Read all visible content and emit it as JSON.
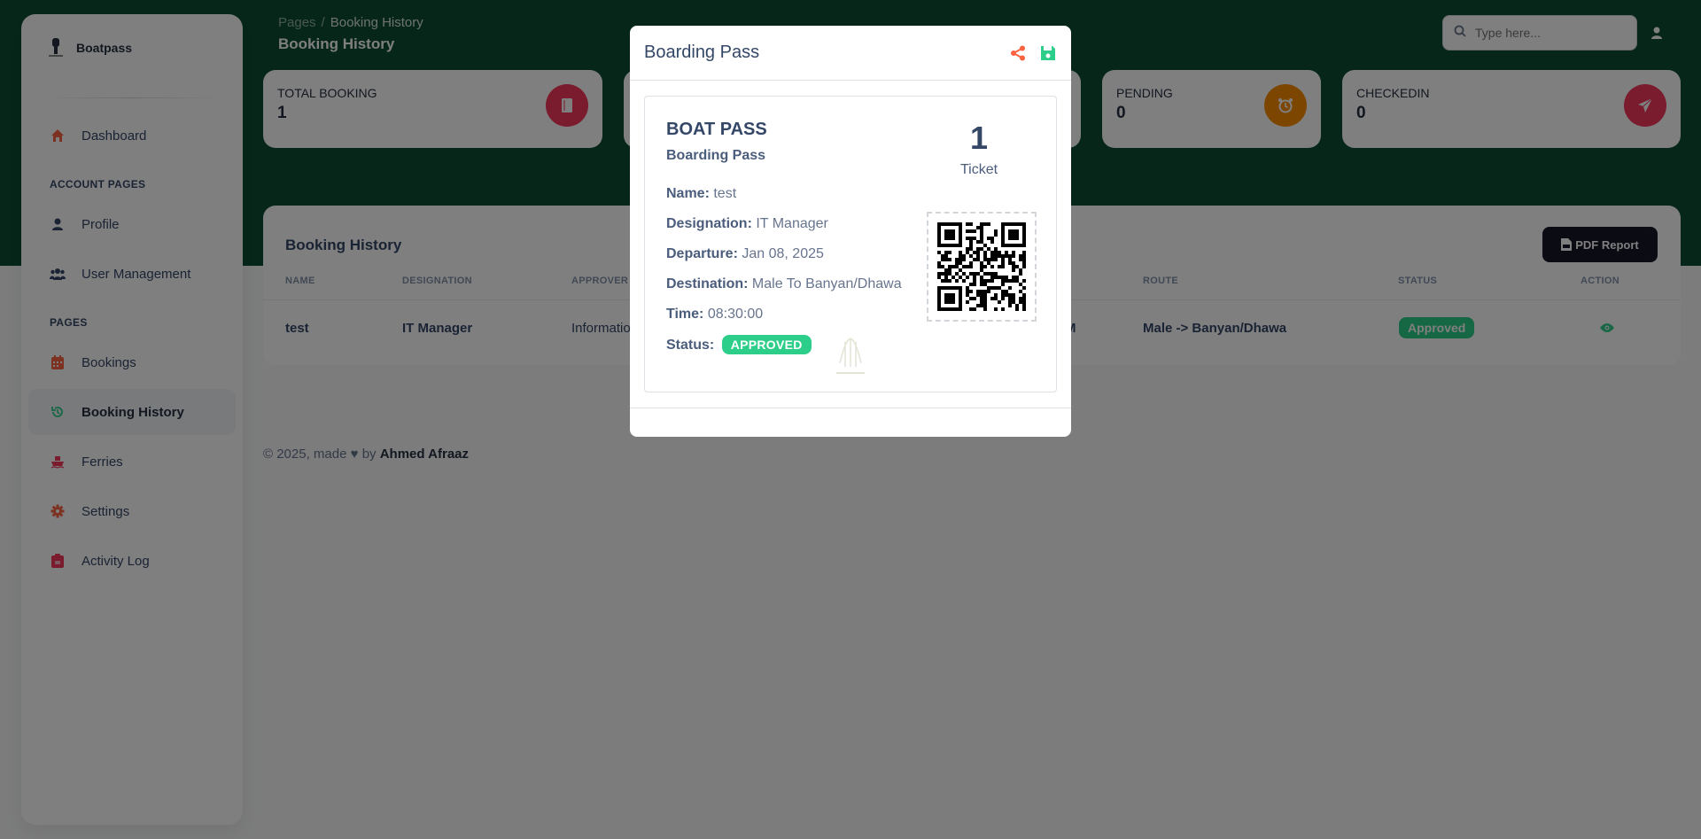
{
  "brand": {
    "name": "Boatpass"
  },
  "sidebar": {
    "items": [
      {
        "label": "Dashboard",
        "icon": "home-icon"
      },
      {
        "label": "Profile",
        "icon": "user-icon"
      },
      {
        "label": "User Management",
        "icon": "users-icon"
      },
      {
        "label": "Bookings",
        "icon": "calendar-icon"
      },
      {
        "label": "Booking History",
        "icon": "history-icon",
        "active": true
      },
      {
        "label": "Ferries",
        "icon": "ship-icon"
      },
      {
        "label": "Settings",
        "icon": "gear-icon"
      },
      {
        "label": "Activity Log",
        "icon": "clipboard-icon"
      }
    ],
    "sections": {
      "account": "ACCOUNT PAGES",
      "pages": "PAGES"
    }
  },
  "header": {
    "breadcrumb_root": "Pages",
    "breadcrumb_sep": "/",
    "breadcrumb_current": "Booking History",
    "title": "Booking History",
    "search_placeholder": "Type here..."
  },
  "stats": [
    {
      "label": "TOTAL BOOKING",
      "value": "1",
      "color": "#f5365c"
    },
    {
      "label": "PENDING",
      "value": "0",
      "color": "#fb8c00"
    },
    {
      "label": "CHECKEDIN",
      "value": "0",
      "color": "#f5365c"
    }
  ],
  "table": {
    "title": "Booking History",
    "pdf_label": "PDF Report",
    "headers": {
      "name": "NAME",
      "designation": "DESIGNATION",
      "approver": "APPROVER",
      "route": "ROUTE",
      "status": "STATUS",
      "action": "ACTION"
    },
    "row": {
      "name": "test",
      "designation": "IT Manager",
      "approver": "Informatio",
      "time_tail": "M",
      "route": "Male -> Banyan/Dhawa",
      "status": "Approved"
    }
  },
  "footer": {
    "prefix": "© 2025, made",
    "by": "by",
    "author": "Ahmed Afraaz"
  },
  "modal": {
    "title": "Boarding Pass",
    "heading": "BOAT PASS",
    "subheading": "Boarding Pass",
    "fields": {
      "name_label": "Name:",
      "name": "test",
      "designation_label": "Designation:",
      "designation": "IT Manager",
      "departure_label": "Departure:",
      "departure": "Jan 08, 2025",
      "destination_label": "Destination:",
      "destination": "Male To Banyan/Dhawa",
      "time_label": "Time:",
      "time": "08:30:00",
      "status_label": "Status:",
      "status": "APPROVED"
    },
    "ticket_count": "1",
    "ticket_label": "Ticket"
  },
  "colors": {
    "hero": "#0b4d32",
    "accent_green": "#2dce89",
    "accent_orange": "#fb6340"
  }
}
